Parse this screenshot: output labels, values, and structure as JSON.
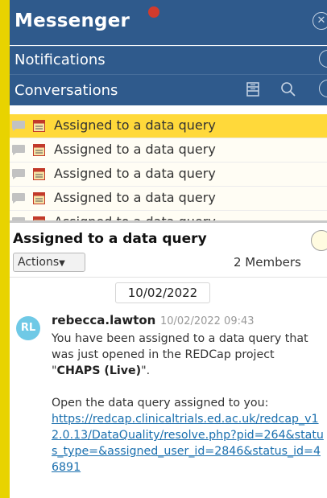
{
  "app": {
    "title": "Messenger"
  },
  "sections": {
    "notifications": "Notifications",
    "conversations": "Conversations"
  },
  "conversation_list": [
    {
      "label": "Assigned to a data query",
      "active": true
    },
    {
      "label": "Assigned to a data query",
      "active": false
    },
    {
      "label": "Assigned to a data query",
      "active": false
    },
    {
      "label": "Assigned to a data query",
      "active": false
    },
    {
      "label": "Assigned to a data query",
      "active": false
    }
  ],
  "conversation": {
    "title": "Assigned to a data query",
    "actions_label": "Actions",
    "members": "2 Members",
    "date": "10/02/2022",
    "message": {
      "avatar_initials": "RL",
      "user": "rebecca.lawton",
      "timestamp": "10/02/2022 09:43",
      "body_prefix": "You have been assigned to a data query that was just opened in the REDCap project \"",
      "project": "CHAPS (Live)",
      "body_suffix": "\".",
      "link_intro": "Open the data query assigned to you:",
      "link": "https://redcap.clinicaltrials.ed.ac.uk/redcap_v12.0.13/DataQuality/resolve.php?pid=264&status_type=&assigned_user_id=2846&status_id=46891"
    }
  },
  "colors": {
    "header": "#2f5a8c",
    "accent": "#e8d300",
    "active_row": "#ffd93a",
    "avatar": "#6fc9e6",
    "link": "#1a6fae"
  }
}
